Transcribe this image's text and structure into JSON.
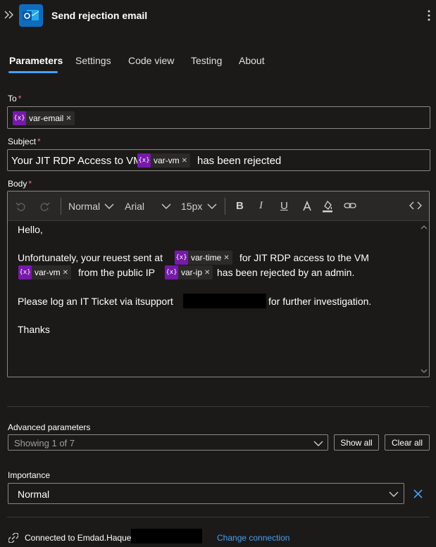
{
  "header": {
    "title": "Send rejection email",
    "app_icon": "outlook-icon",
    "collapse_icon": "double-chevron-right-icon",
    "more_icon": "more-vertical-icon"
  },
  "tabs": [
    {
      "label": "Parameters",
      "active": true
    },
    {
      "label": "Settings"
    },
    {
      "label": "Code view"
    },
    {
      "label": "Testing"
    },
    {
      "label": "About"
    }
  ],
  "to": {
    "label": "To",
    "required": "*",
    "tokens": [
      {
        "icon": "{x}",
        "label": "var-email"
      }
    ]
  },
  "subject": {
    "label": "Subject",
    "required": "*",
    "text_before": "Your JIT RDP Access to VM",
    "token": "var-vm",
    "text_after": "has been rejected"
  },
  "body": {
    "label": "Body",
    "required": "*",
    "toolbar": {
      "style": "Normal",
      "font": "Arial",
      "size": "15px"
    },
    "line1": "Hello,",
    "line2a": "Unfortunately, your reuest sent at",
    "token_time": "var-time",
    "line2b": "for JIT RDP access to the VM",
    "token_vm": "var-vm",
    "line3a": "from the public IP",
    "token_ip": "var-ip",
    "line3b": "has been rejected by an admin.",
    "line4a": "Please log an IT Ticket via itsupport",
    "line4b": "for further investigation.",
    "line5": "Thanks"
  },
  "token_icon_glyph": "{x}",
  "advanced": {
    "label": "Advanced parameters",
    "value": "Showing 1 of 7",
    "show_all": "Show all",
    "clear_all": "Clear all"
  },
  "importance": {
    "label": "Importance",
    "value": "Normal"
  },
  "footer": {
    "connected": "Connected to Emdad.Haque",
    "change": "Change connection"
  },
  "colors": {
    "accent": "#479ef5",
    "token": "#7719aa",
    "app": "#0f6cbd",
    "required": "#f1707b"
  }
}
